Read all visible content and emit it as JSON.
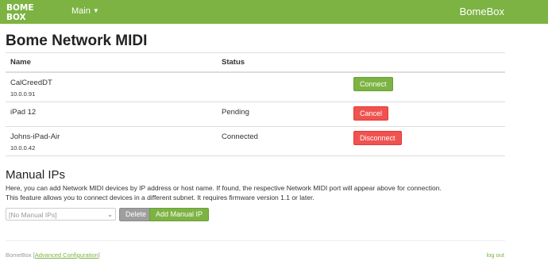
{
  "colors": {
    "accent": "#7cb342",
    "danger": "#ef5350",
    "muted": "#9e9e9e"
  },
  "navbar": {
    "logo_text": [
      "BOME",
      "BOX"
    ],
    "main_menu_label": "Main",
    "brand": "BomeBox"
  },
  "page_title": "Bome Network MIDI",
  "devices_table": {
    "headers": {
      "name": "Name",
      "status": "Status"
    },
    "rows": [
      {
        "name": "CalCreedDT",
        "ip": "10.0.0.91",
        "status": "",
        "action": "Connect",
        "action_color": "green"
      },
      {
        "name": "iPad 12",
        "ip": "",
        "status": "Pending",
        "action": "Cancel",
        "action_color": "red"
      },
      {
        "name": "Johns-iPad-Air",
        "ip": "10.0.0.42",
        "status": "Connected",
        "action": "Disconnect",
        "action_color": "red"
      }
    ]
  },
  "manual": {
    "title": "Manual IPs",
    "desc_line1": "Here, you can add Network MIDI devices by IP address or host name. If found, the respective Network MIDI port will appear above for connection.",
    "desc_line2": "This feature allows you to connect devices in a different subnet. It requires firmware version 1.1 or later.",
    "select_value": "[No Manual IPs]",
    "delete_label": "Delete",
    "add_label": "Add Manual IP"
  },
  "footer": {
    "brand": "BomeBox",
    "open_bracket": "[",
    "advanced_link": "Advanced Configuration",
    "close_bracket": "]",
    "logout": "log out"
  }
}
